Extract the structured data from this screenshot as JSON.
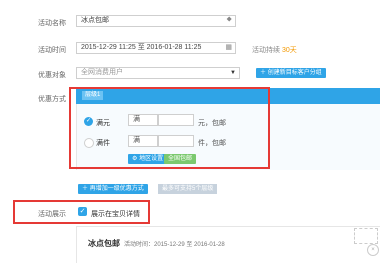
{
  "form": {
    "activity_name": {
      "label": "活动名称",
      "value": "冰点包邮"
    },
    "activity_time": {
      "label": "活动时间",
      "value": "2015-12-29 11:25 至 2016-01-28 11:25",
      "duration_label": "活动持续",
      "duration_value": "30天"
    },
    "promo_target": {
      "label": "优惠对象",
      "value": "全网消费用户",
      "create_group_btn": "创建新目标客户分组"
    },
    "promo_method": {
      "label": "优惠方式",
      "tier_tag": "层级1",
      "rule1": {
        "option": "满元",
        "prefix": "满",
        "suffix": "元，包邮"
      },
      "rule2": {
        "option": "满件",
        "prefix": "满",
        "suffix": "件，包邮"
      },
      "region_btn": "地区设置",
      "all_region_btn": "全国包邮",
      "add_tier_btn": "再增加一级优惠方式",
      "hint_btn": "最多可支持5个层级"
    },
    "display": {
      "label": "活动展示",
      "checkbox_label": "展示在宝贝详情"
    },
    "preview": {
      "name": "冰点包邮",
      "time_label": "活动时间：",
      "time_value": "2015-12-29 至 2016-01-28"
    }
  },
  "colors": {
    "accent": "#2fa4e7",
    "highlight": "#e53935",
    "success": "#7bc96f",
    "orange": "#f39800"
  }
}
